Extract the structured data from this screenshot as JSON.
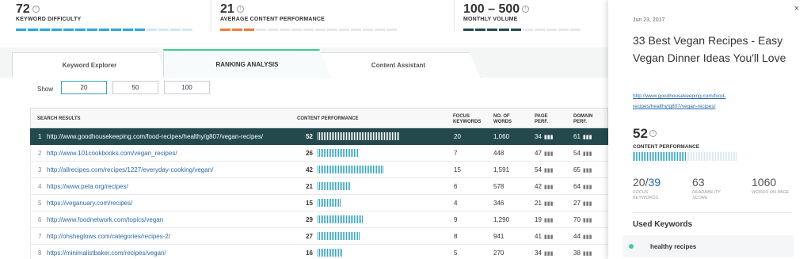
{
  "metrics": [
    {
      "value": "72",
      "label": "KEYWORD DIFFICULTY",
      "color": "#29a8d8"
    },
    {
      "value": "21",
      "label": "AVERAGE CONTENT PERFORMANCE",
      "color": "#f07a3a"
    },
    {
      "value": "100 – 500",
      "label": "MONTHLY VOLUME",
      "color": "#23494c"
    }
  ],
  "tabs": [
    {
      "label": "Keyword Explorer"
    },
    {
      "label": "RANKING ANALYSIS"
    },
    {
      "label": "Content Assistant"
    }
  ],
  "show": {
    "label": "Show",
    "options": [
      "20",
      "50",
      "100"
    ],
    "selected": "20"
  },
  "table": {
    "headers": {
      "search_results": "SEARCH RESULTS",
      "content_performance": "CONTENT PERFORMANCE",
      "focus_keywords": "FOCUS KEYWORDS",
      "no_of_words": "NO. OF WORDS",
      "page_perf": "PAGE PERF.",
      "domain_perf": "DOMAIN PERF."
    },
    "rows": [
      {
        "num": "1",
        "url": "http://www.goodhousekeeping.com/food-recipes/healthy/g807/vegan-recipes/",
        "cp": "52",
        "fk": "20",
        "nw": "1,060",
        "pp": "34",
        "dp": "61"
      },
      {
        "num": "2",
        "url": "http://www.101cookbooks.com/vegan_recipes/",
        "cp": "26",
        "fk": "7",
        "nw": "448",
        "pp": "47",
        "dp": "54"
      },
      {
        "num": "3",
        "url": "http://allrecipes.com/recipes/1227/everyday-cooking/vegan/",
        "cp": "42",
        "fk": "15",
        "nw": "1,591",
        "pp": "54",
        "dp": "65"
      },
      {
        "num": "4",
        "url": "https://www.peta.org/recipes/",
        "cp": "21",
        "fk": "6",
        "nw": "578",
        "pp": "42",
        "dp": "64"
      },
      {
        "num": "5",
        "url": "https://veganuary.com/recipes/",
        "cp": "15",
        "fk": "4",
        "nw": "346",
        "pp": "21",
        "dp": "27"
      },
      {
        "num": "6",
        "url": "http://www.foodnetwork.com/topics/vegan",
        "cp": "29",
        "fk": "9",
        "nw": "1,290",
        "pp": "19",
        "dp": "70"
      },
      {
        "num": "7",
        "url": "http://ohsheglows.com/categories/recipes-2/",
        "cp": "27",
        "fk": "8",
        "nw": "941",
        "pp": "41",
        "dp": "44"
      },
      {
        "num": "8",
        "url": "https://minimalistbaker.com/recipes/vegan/",
        "cp": "16",
        "fk": "5",
        "nw": "270",
        "pp": "34",
        "dp": "38"
      }
    ]
  },
  "panel": {
    "close": "×",
    "date": "Jun 23, 2017",
    "title": "33 Best Vegan Recipes - Easy Vegan Dinner Ideas You'll Love",
    "link": "http://www.goodhousekeeping.com/food-recipes/healthy/g807/vegan-recipes/",
    "content_performance": {
      "value": "52",
      "label": "CONTENT PERFORMANCE"
    },
    "stats": [
      {
        "a": "20",
        "b": "39",
        "label": "FOCUS KEYWORDS"
      },
      {
        "a": "63",
        "b": "",
        "label": "READABILITY SCORE"
      },
      {
        "a": "1060",
        "b": "",
        "label": "WORDS ON PAGE"
      }
    ],
    "used_keywords_title": "Used Keywords",
    "keywords": [
      "healthy recipes"
    ]
  }
}
